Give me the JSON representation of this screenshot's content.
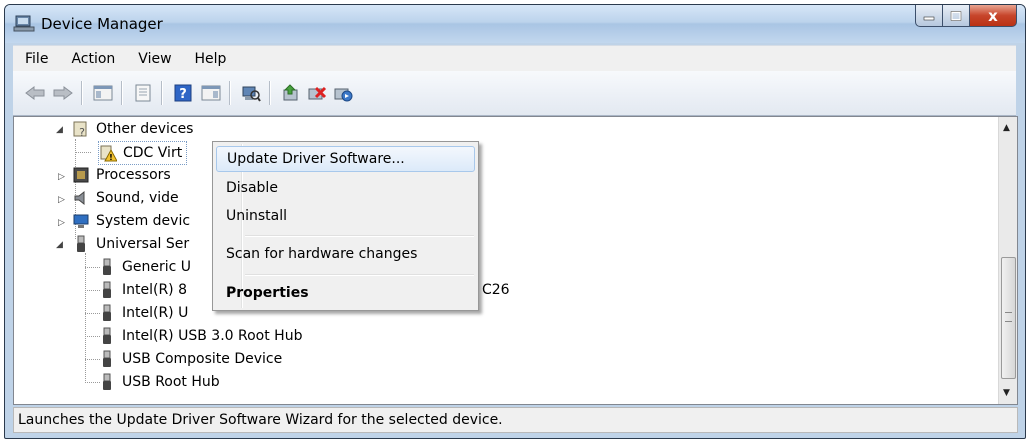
{
  "window": {
    "title": "Device Manager",
    "close_glyph": "x"
  },
  "menu": [
    "File",
    "Action",
    "View",
    "Help"
  ],
  "toolbar_icons": [
    "back-icon",
    "forward-icon",
    "show-hide-console-tree-icon",
    "properties-icon",
    "help-icon",
    "action-pane-icon",
    "scan-hardware-icon",
    "update-driver-icon",
    "uninstall-icon",
    "enable-device-icon"
  ],
  "tree": {
    "rows": [
      {
        "label": "Other devices",
        "icon": "unknown-device-folder-icon"
      },
      {
        "label": "CDC Virt",
        "icon": "warning-device-icon"
      },
      {
        "label": "Processors",
        "icon": "processor-icon"
      },
      {
        "label": "Sound, vide",
        "icon": "speaker-icon"
      },
      {
        "label": "System devic",
        "icon": "computer-icon"
      },
      {
        "label": "Universal Ser",
        "icon": "usb-icon"
      },
      {
        "label": "Generic U",
        "icon": "usb-plug-icon"
      },
      {
        "label": "Intel(R) 8",
        "icon": "usb-plug-icon"
      },
      {
        "label": "Intel(R) U",
        "icon": "usb-plug-icon"
      },
      {
        "label": "Intel(R) USB 3.0 Root Hub",
        "icon": "usb-plug-icon"
      },
      {
        "label": "USB Composite Device",
        "icon": "usb-plug-icon"
      },
      {
        "label": "USB Root Hub",
        "icon": "usb-plug-icon"
      }
    ],
    "obscured_suffix": "C26"
  },
  "context_menu": {
    "items": [
      {
        "label": "Update Driver Software...",
        "highlighted": true
      },
      {
        "label": "Disable"
      },
      {
        "label": "Uninstall"
      },
      {
        "label": "Scan for hardware changes"
      },
      {
        "label": "Properties",
        "bold": true
      }
    ]
  },
  "status": {
    "text": "Launches the Update Driver Software Wizard for the selected device."
  },
  "colors": {
    "title_bar": "#bcd3ec",
    "close_button": "#c7452b",
    "highlight": "#dceaf9"
  }
}
